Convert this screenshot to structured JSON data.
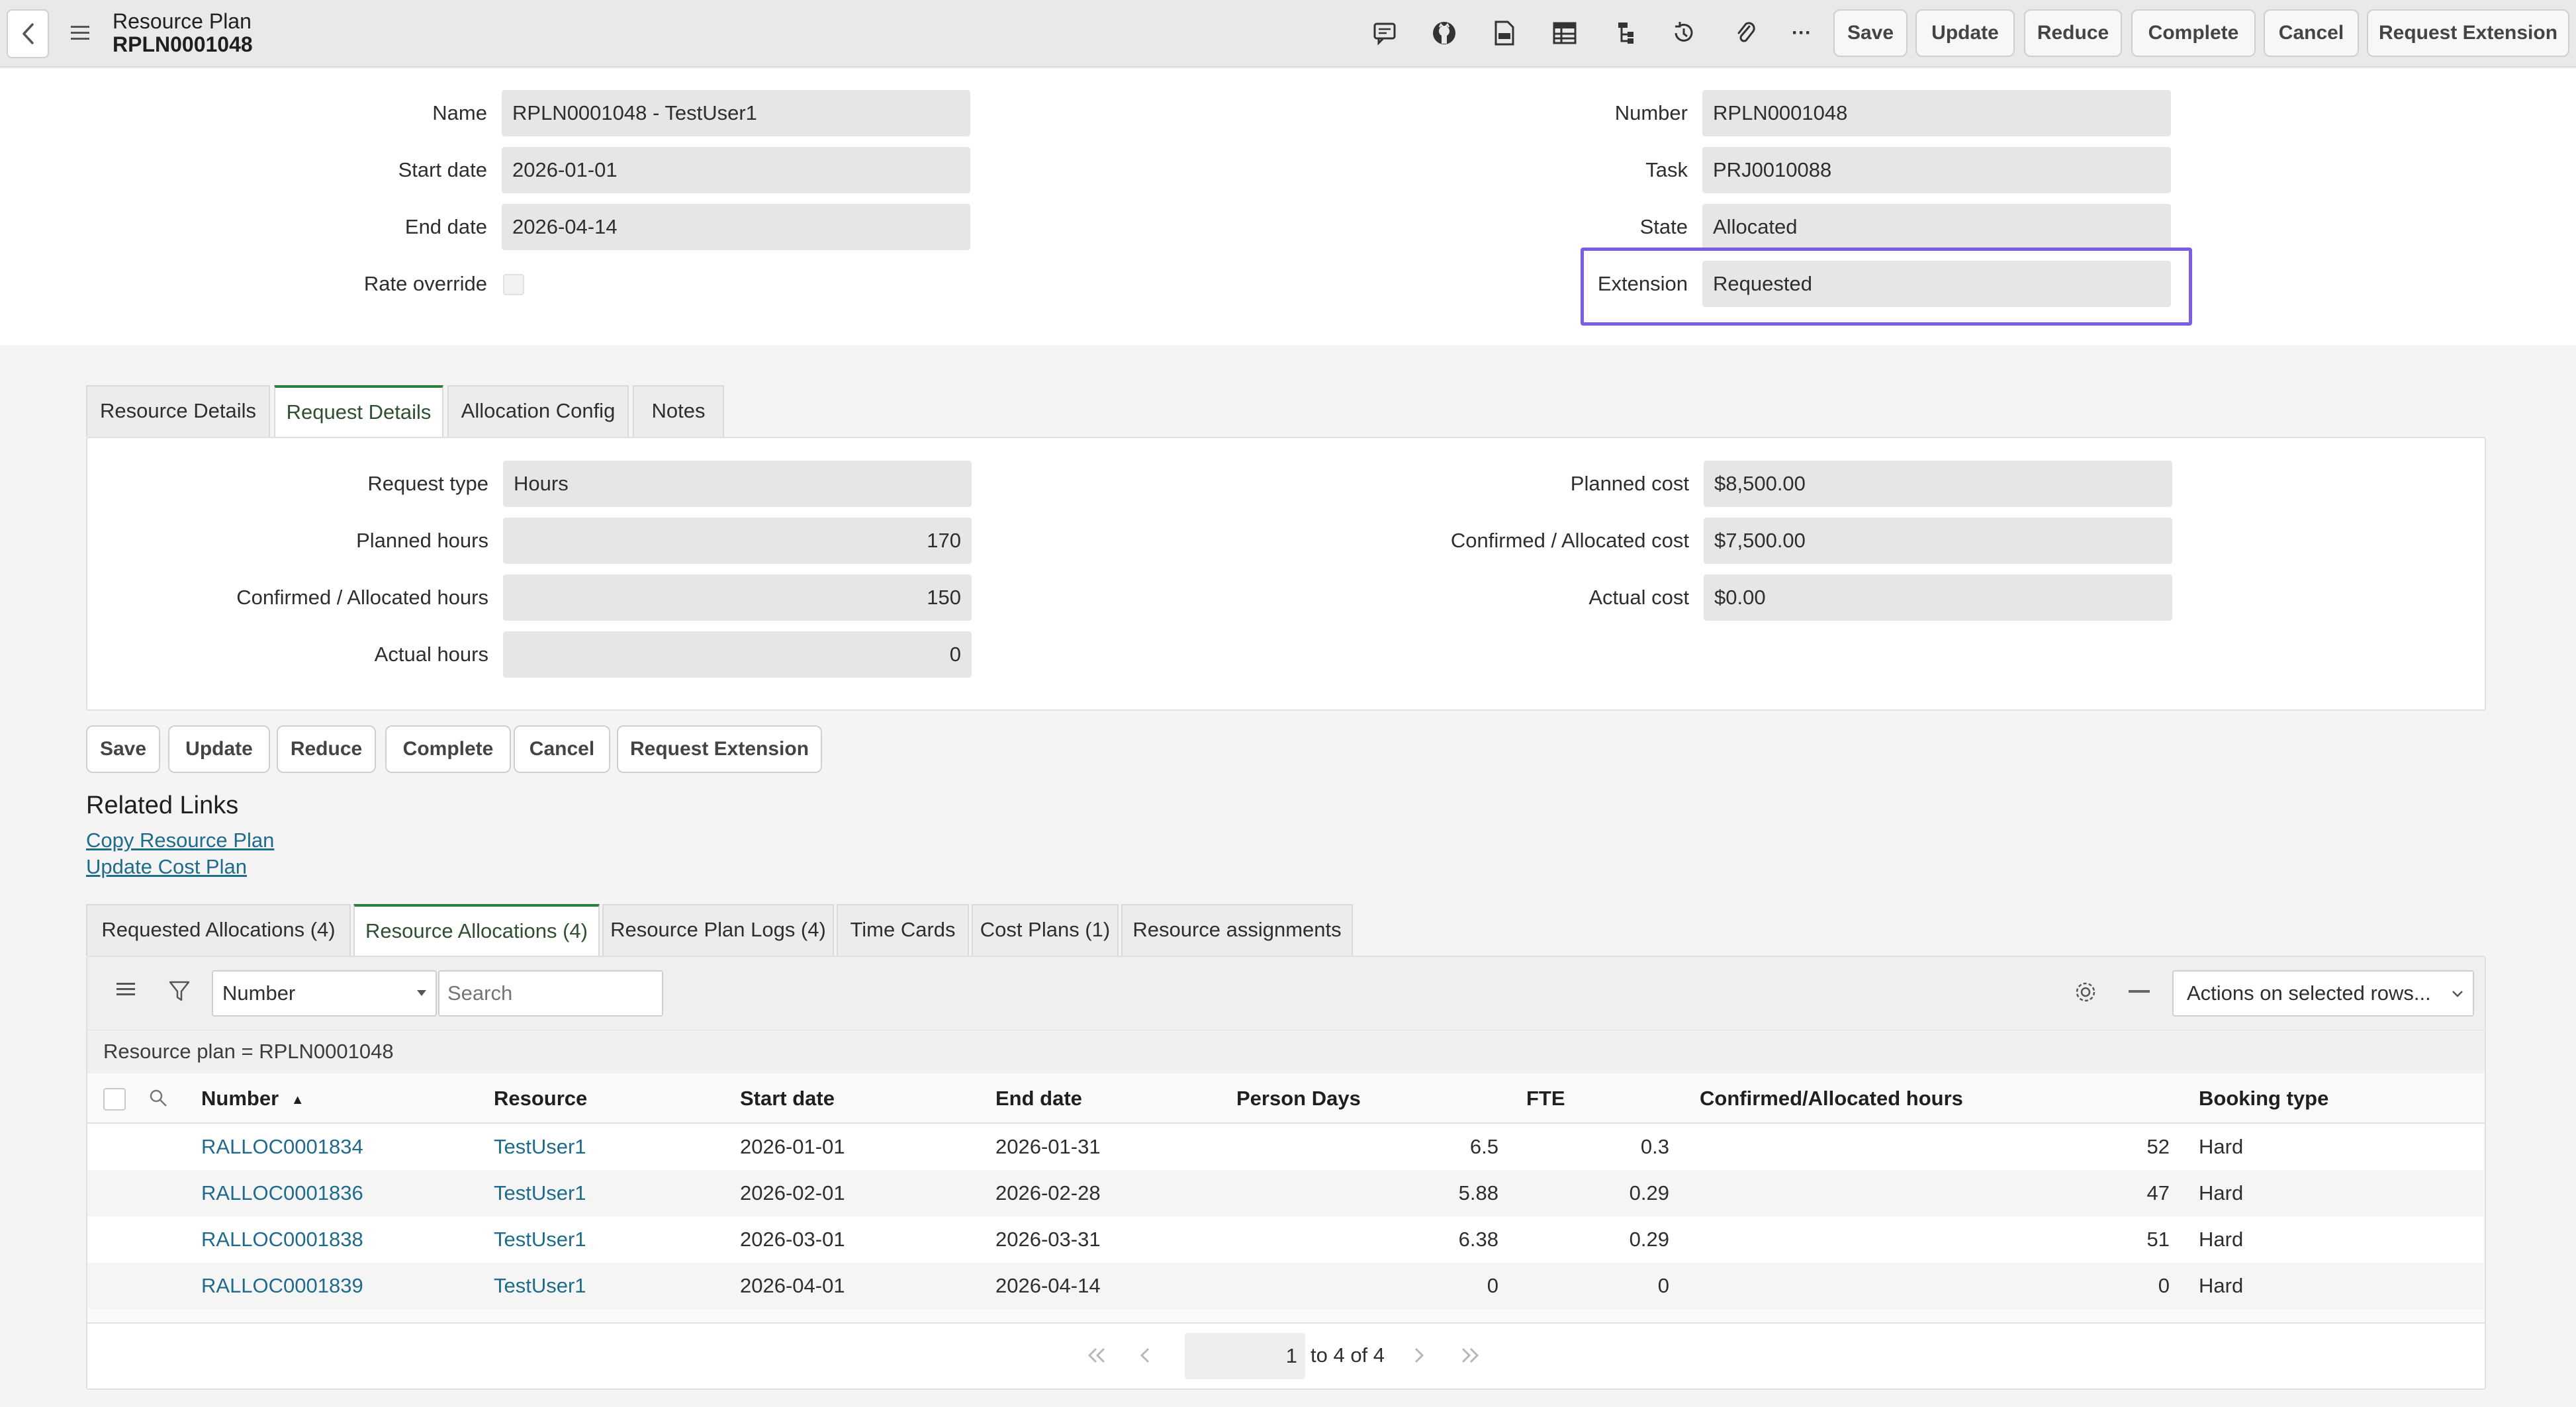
{
  "header": {
    "title": "Resource Plan",
    "record_number": "RPLN0001048",
    "more_label": "···",
    "buttons": {
      "save": "Save",
      "update": "Update",
      "reduce": "Reduce",
      "complete": "Complete",
      "cancel": "Cancel",
      "request_extension": "Request Extension"
    },
    "icons": [
      "back-icon",
      "menu-icon",
      "comment-icon",
      "github-icon",
      "document-icon",
      "table-icon",
      "hierarchy-icon",
      "history-icon",
      "attachment-icon",
      "more-icon"
    ]
  },
  "form": {
    "left": [
      {
        "label": "Name",
        "value": "RPLN0001048 - TestUser1"
      },
      {
        "label": "Start date",
        "value": "2026-01-01"
      },
      {
        "label": "End date",
        "value": "2026-04-14"
      },
      {
        "label": "Rate override",
        "value": ""
      }
    ],
    "right": [
      {
        "label": "Number",
        "value": "RPLN0001048"
      },
      {
        "label": "Task",
        "value": "PRJ0010088"
      },
      {
        "label": "State",
        "value": "Allocated"
      },
      {
        "label": "Extension",
        "value": "Requested"
      }
    ],
    "highlight_color": "#7b5ce6"
  },
  "section_tabs": [
    "Resource Details",
    "Request Details",
    "Allocation Config",
    "Notes"
  ],
  "section_tab_active": "Request Details",
  "request_details": {
    "left": [
      {
        "label": "Request type",
        "value": "Hours"
      },
      {
        "label": "Planned hours",
        "value": "170"
      },
      {
        "label": "Confirmed / Allocated hours",
        "value": "150"
      },
      {
        "label": "Actual hours",
        "value": "0"
      }
    ],
    "right": [
      {
        "label": "Planned cost",
        "value": "$8,500.00"
      },
      {
        "label": "Confirmed / Allocated cost",
        "value": "$7,500.00"
      },
      {
        "label": "Actual cost",
        "value": "$0.00"
      }
    ]
  },
  "bottom_buttons": {
    "save": "Save",
    "update": "Update",
    "reduce": "Reduce",
    "complete": "Complete",
    "cancel": "Cancel",
    "request_extension": "Request Extension"
  },
  "related_links": {
    "title": "Related Links",
    "links": [
      "Copy Resource Plan",
      "Update Cost Plan"
    ]
  },
  "related_tabs": [
    "Requested Allocations (4)",
    "Resource Allocations (4)",
    "Resource Plan Logs (4)",
    "Time Cards",
    "Cost Plans (1)",
    "Resource assignments"
  ],
  "related_tab_active": "Resource Allocations (4)",
  "list": {
    "search_field": "Number",
    "search_placeholder": "Search",
    "actions_label": "Actions on selected rows...",
    "filter_text": "Resource plan = RPLN0001048",
    "columns": [
      "Number",
      "Resource",
      "Start date",
      "End date",
      "Person Days",
      "FTE",
      "Confirmed/Allocated hours",
      "Booking type"
    ],
    "sort_indicator": "▲",
    "rows": [
      [
        "RALLOC0001834",
        "TestUser1",
        "2026-01-01",
        "2026-01-31",
        "6.5",
        "0.3",
        "52",
        "Hard"
      ],
      [
        "RALLOC0001836",
        "TestUser1",
        "2026-02-01",
        "2026-02-28",
        "5.88",
        "0.29",
        "47",
        "Hard"
      ],
      [
        "RALLOC0001838",
        "TestUser1",
        "2026-03-01",
        "2026-03-31",
        "6.38",
        "0.29",
        "51",
        "Hard"
      ],
      [
        "RALLOC0001839",
        "TestUser1",
        "2026-04-01",
        "2026-04-14",
        "0",
        "0",
        "0",
        "Hard"
      ]
    ],
    "pagination": {
      "page": "1",
      "range_text": "to 4 of 4"
    }
  },
  "colors": {
    "accent_green": "#2d7e3f",
    "link_blue": "#1f6b8c",
    "highlight_purple": "#7b5ce6"
  }
}
